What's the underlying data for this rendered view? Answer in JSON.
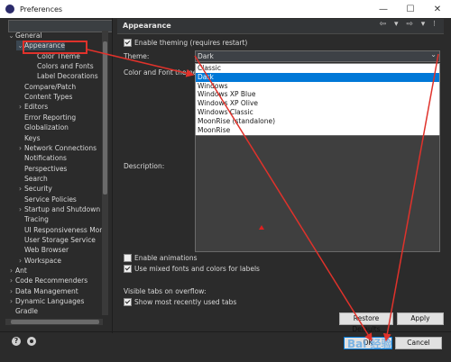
{
  "window": {
    "title": "Preferences",
    "minimize_icon": "—",
    "maximize_icon": "☐",
    "close_icon": "✕"
  },
  "sidebar": {
    "filter_placeholder": "",
    "items": [
      {
        "label": "General",
        "arrow": "⌄",
        "indent": 0
      },
      {
        "label": "Appearance",
        "arrow": "⌄",
        "indent": 1
      },
      {
        "label": "Color Theme",
        "arrow": "",
        "indent": 2
      },
      {
        "label": "Colors and Fonts",
        "arrow": "",
        "indent": 2
      },
      {
        "label": "Label Decorations",
        "arrow": "",
        "indent": 2
      },
      {
        "label": "Compare/Patch",
        "arrow": "",
        "indent": 1
      },
      {
        "label": "Content Types",
        "arrow": "",
        "indent": 1
      },
      {
        "label": "Editors",
        "arrow": "›",
        "indent": 1
      },
      {
        "label": "Error Reporting",
        "arrow": "",
        "indent": 1
      },
      {
        "label": "Globalization",
        "arrow": "",
        "indent": 1
      },
      {
        "label": "Keys",
        "arrow": "",
        "indent": 1
      },
      {
        "label": "Network Connections",
        "arrow": "›",
        "indent": 1
      },
      {
        "label": "Notifications",
        "arrow": "",
        "indent": 1
      },
      {
        "label": "Perspectives",
        "arrow": "",
        "indent": 1
      },
      {
        "label": "Search",
        "arrow": "",
        "indent": 1
      },
      {
        "label": "Security",
        "arrow": "›",
        "indent": 1
      },
      {
        "label": "Service Policies",
        "arrow": "",
        "indent": 1
      },
      {
        "label": "Startup and Shutdown",
        "arrow": "›",
        "indent": 1
      },
      {
        "label": "Tracing",
        "arrow": "",
        "indent": 1
      },
      {
        "label": "UI Responsiveness Mon",
        "arrow": "",
        "indent": 1
      },
      {
        "label": "User Storage Service",
        "arrow": "",
        "indent": 1
      },
      {
        "label": "Web Browser",
        "arrow": "",
        "indent": 1
      },
      {
        "label": "Workspace",
        "arrow": "›",
        "indent": 1
      },
      {
        "label": "Ant",
        "arrow": "›",
        "indent": 0
      },
      {
        "label": "Code Recommenders",
        "arrow": "›",
        "indent": 0
      },
      {
        "label": "Data Management",
        "arrow": "›",
        "indent": 0
      },
      {
        "label": "Dynamic Languages",
        "arrow": "›",
        "indent": 0
      },
      {
        "label": "Gradle",
        "arrow": "",
        "indent": 0
      }
    ]
  },
  "page": {
    "title": "Appearance",
    "nav_icons": "⇦ ▾ ⇨ ▾ ⁝",
    "enable_theming_label": "Enable theming (requires restart)",
    "theme_label": "Theme:",
    "theme_value": "Dark",
    "theme_chevron": "⌄",
    "color_font_theme_label": "Color and Font theme:",
    "theme_options": [
      "Classic",
      "Dark",
      "Windows",
      "Windows XP Blue",
      "Windows XP Olive",
      "Windows Classic",
      "MoonRise (standalone)",
      "MoonRise"
    ],
    "description_label": "Description:",
    "enable_animations_label": "Enable animations",
    "mixed_fonts_label": "Use mixed fonts and colors for labels",
    "visible_tabs_label": "Visible tabs on overflow:",
    "most_recent_label": "Show most recently used tabs",
    "restore_defaults_label": "Restore Defaults",
    "apply_label": "Apply"
  },
  "footer": {
    "help_icon_glyph": "?",
    "ok_label": "OK",
    "cancel_label": "Cancel"
  },
  "watermark": {
    "text": "Bai 经验"
  },
  "colors": {
    "accent": "#e0322b",
    "selection": "#0078d7"
  }
}
